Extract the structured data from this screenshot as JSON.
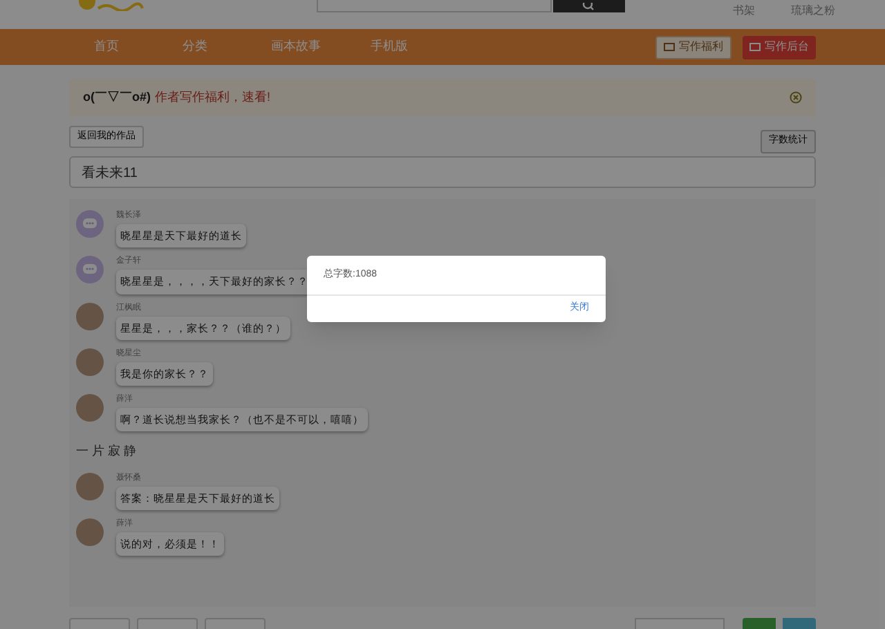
{
  "header": {
    "links": [
      "书架",
      "琉璃之粉"
    ]
  },
  "nav": {
    "items": [
      {
        "label": "首页"
      },
      {
        "label": "分类"
      },
      {
        "label": "画本故事"
      },
      {
        "label": "手机版"
      }
    ],
    "buttons": [
      {
        "label": "写作福利",
        "kind": "light"
      },
      {
        "label": "写作后台",
        "kind": "red"
      }
    ]
  },
  "notice": {
    "emoticon": "o(￣▽￣o#)",
    "text": "作者写作福利，速看!"
  },
  "back_button": "返回我的作品",
  "count_button": "字数统计",
  "title_field": {
    "value": "看未来11"
  },
  "chat": [
    {
      "kind": "icon_message",
      "name": "魏长泽",
      "text": "晓星星是天下最好的道长"
    },
    {
      "kind": "icon_message",
      "name": "金子轩",
      "text": "晓星星是，，，，天下最好的家长？？"
    },
    {
      "kind": "photo_message",
      "name": "江枫眠",
      "text": "星星是，，，家长？？（谁的？）"
    },
    {
      "kind": "photo_message",
      "name": "晓星尘",
      "text": "我是你的家长？？"
    },
    {
      "kind": "photo_message",
      "name": "薛洋",
      "text": "啊？道长说想当我家长？（也不是不可以，嘻嘻）"
    },
    {
      "kind": "narration",
      "text": "一 片 寂 静"
    },
    {
      "kind": "photo_message",
      "name": "聂怀桑",
      "text": "答案：晓星星是天下最好的道长"
    },
    {
      "kind": "photo_message",
      "name": "薛洋",
      "text": "说的对，必须是！！"
    }
  ],
  "dialog": {
    "message": "总字数:1088",
    "close": "关闭"
  }
}
